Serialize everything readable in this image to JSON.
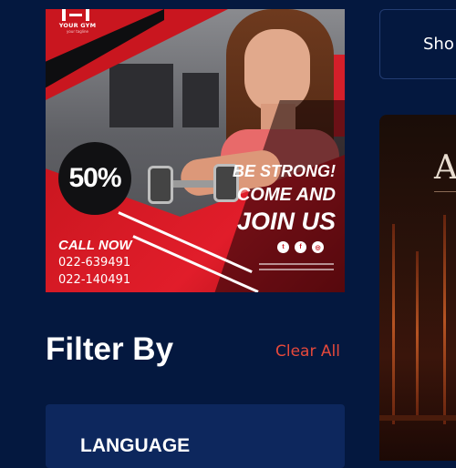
{
  "promo": {
    "brand": "YOUR GYM",
    "brand_tagline": "your tagline",
    "discount": "50%",
    "slogan_line1": "BE STRONG!",
    "slogan_line2": "COME AND",
    "slogan_line3": "JOIN US",
    "call_label": "CALL NOW",
    "phone1": "022-639491",
    "phone2": "022-140491",
    "social_icons": [
      "twitter-icon",
      "facebook-icon",
      "instagram-icon"
    ],
    "accent_color": "#d41f2a"
  },
  "filter": {
    "title": "Filter By",
    "clear_label": "Clear All",
    "clear_color": "#e6493b",
    "section_label": "LANGUAGE"
  },
  "right_panel": {
    "show_label": "Sho",
    "card_title_letter": "A"
  },
  "colors": {
    "page_bg": "#04183f",
    "card_bg": "#0d275d"
  }
}
